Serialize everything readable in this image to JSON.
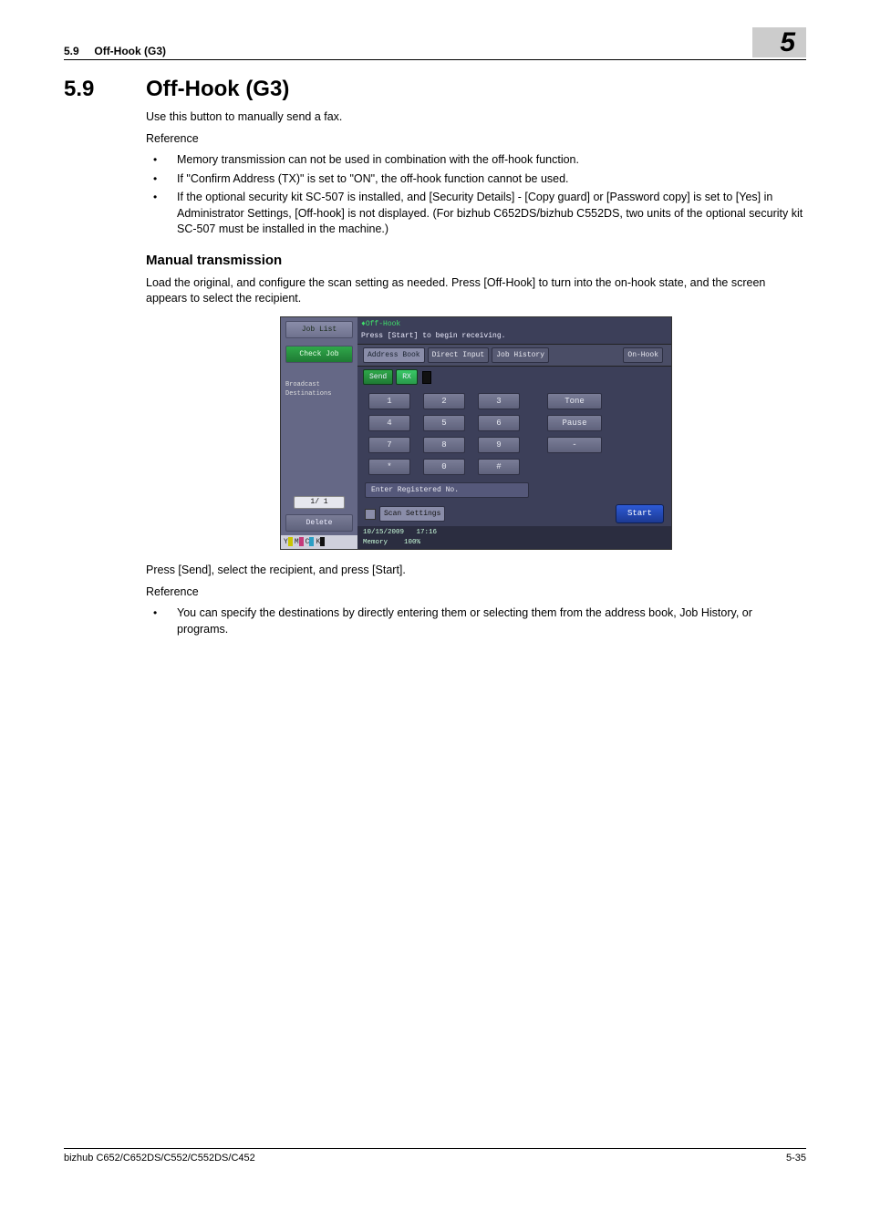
{
  "header": {
    "section_num_top": "5.9",
    "section_title_top": "Off-Hook (G3)",
    "chapter_big": "5"
  },
  "heading": {
    "num": "5.9",
    "title": "Off-Hook (G3)"
  },
  "intro": "Use this button to manually send a fax.",
  "reference_label": "Reference",
  "ref1_items": [
    "Memory transmission can not be used in combination with the off-hook function.",
    "If \"Confirm Address (TX)\" is set to \"ON\", the off-hook function cannot be used.",
    "If the optional security kit SC-507 is installed, and [Security Details] - [Copy guard] or [Password copy] is set to [Yes] in Administrator Settings, [Off-hook] is not displayed. (For bizhub C652DS/bizhub C552DS, two units of the optional security kit SC-507 must be installed in the machine.)"
  ],
  "sub1_title": "Manual transmission",
  "sub1_text": "Load the original, and configure the scan setting as needed. Press [Off-Hook] to turn into the on-hook state, and the screen appears to select the recipient.",
  "post_shot_text": "Press [Send], select the recipient, and press [Start].",
  "ref2_items": [
    "You can specify the destinations by directly entering them or selecting them from the address book, Job History, or programs."
  ],
  "footer": {
    "left": "bizhub C652/C652DS/C552/C552DS/C452",
    "right": "5-35"
  },
  "shot": {
    "job_list": "Job List",
    "check_job": "Check Job",
    "broadcast": "Broadcast\nDestinations",
    "page_ind": "1/  1",
    "delete": "Delete",
    "hdr_line1": "Off-Hook",
    "hdr_line2": "Press [Start] to begin receiving.",
    "tab_addr": "Address Book",
    "tab_direct": "Direct Input",
    "tab_hist": "Job History",
    "on_hook": "On-Hook",
    "send": "Send",
    "rx": "RX",
    "keys": [
      "1",
      "2",
      "3",
      "4",
      "5",
      "6",
      "7",
      "8",
      "9",
      "*",
      "0",
      "#"
    ],
    "side": [
      "Tone",
      "Pause",
      "-"
    ],
    "reg_no": "Enter Registered No.",
    "scan_settings": "Scan Settings",
    "start": "Start",
    "supplies": [
      "Y",
      "M",
      "C",
      "K"
    ],
    "date": "10/15/2009",
    "time": "17:16",
    "memory": "Memory",
    "mempct": "100%"
  }
}
